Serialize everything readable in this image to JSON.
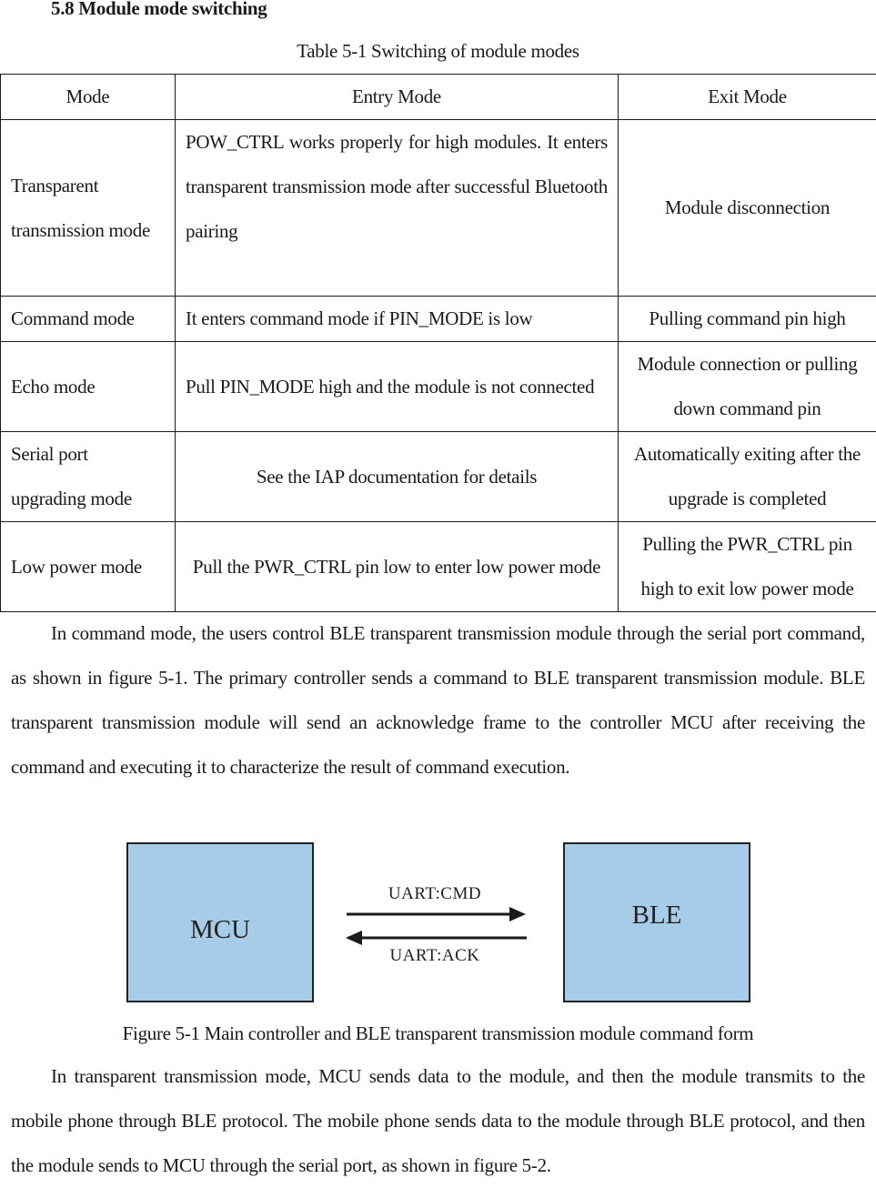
{
  "section": {
    "heading": "5.8 Module mode switching"
  },
  "table": {
    "caption": "Table 5-1 Switching of module modes",
    "headers": [
      "Mode",
      "Entry Mode",
      "Exit Mode"
    ],
    "rows": [
      {
        "mode": "Transparent transmission mode",
        "entry": "POW_CTRL works properly for high modules. It enters transparent transmission mode after successful Bluetooth pairing",
        "exit": "Module disconnection"
      },
      {
        "mode": "Command mode",
        "entry": "It enters command mode if PIN_MODE is low",
        "exit": "Pulling command pin high"
      },
      {
        "mode": "Echo mode",
        "entry": "Pull PIN_MODE high and the module is not connected",
        "exit": "Module connection or pulling down command pin"
      },
      {
        "mode": "Serial port upgrading mode",
        "entry": "See the IAP documentation for details",
        "exit": "Automatically exiting after the upgrade is completed"
      },
      {
        "mode": "Low power mode",
        "entry": "Pull the PWR_CTRL pin low to enter low power mode",
        "exit": "Pulling the PWR_CTRL pin high to exit low power mode"
      }
    ]
  },
  "paragraphs": {
    "command_mode": "In command mode, the users control BLE transparent transmission module through the serial port command, as shown in figure 5-1. The primary controller sends a command to BLE transparent transmission module. BLE transparent transmission module will send an acknowledge frame to the controller MCU after receiving the command and executing it to characterize the result of command execution.",
    "transparent_mode": "In transparent transmission mode, MCU sends data to the module, and then the module transmits to the mobile phone through BLE protocol. The mobile phone sends data to the module through BLE protocol, and then the module sends to MCU through the serial port, as shown in figure 5-2."
  },
  "figure": {
    "left_block": "MCU",
    "right_block": "BLE",
    "top_arrow_label": "UART:CMD",
    "bottom_arrow_label": "UART:ACK",
    "block_color": "#a6cce8",
    "caption": "Figure 5-1 Main controller and BLE transparent transmission module command form"
  }
}
